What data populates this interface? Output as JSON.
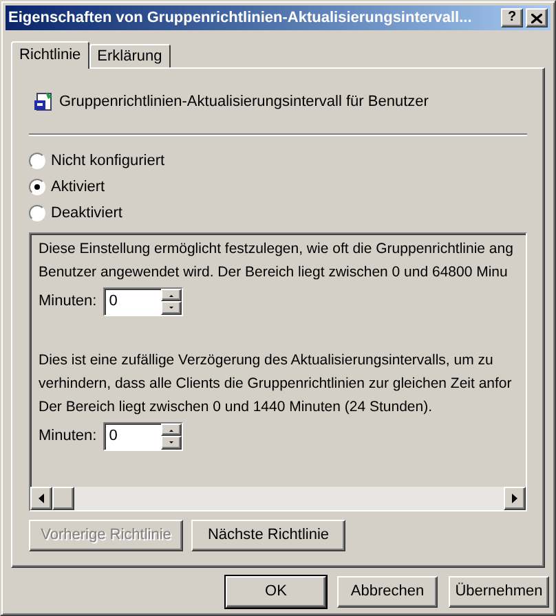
{
  "window": {
    "title": "Eigenschaften von Gruppenrichtlinien-Aktualisierungsintervall...",
    "help_button": "?"
  },
  "tabs": [
    {
      "label": "Richtlinie",
      "selected": true
    },
    {
      "label": "Erklärung",
      "selected": false
    }
  ],
  "policy": {
    "name": "Gruppenrichtlinien-Aktualisierungsintervall für Benutzer"
  },
  "options": [
    {
      "label": "Nicht konfiguriert",
      "selected": false
    },
    {
      "label": "Aktiviert",
      "selected": true
    },
    {
      "label": "Deaktiviert",
      "selected": false
    }
  ],
  "settings": [
    {
      "lines": [
        "Diese Einstellung ermöglicht festzulegen, wie oft die Gruppenrichtlinie ang",
        "Benutzer angewendet wird. Der Bereich liegt zwischen 0 und 64800 Minu"
      ],
      "field_label": "Minuten:",
      "value": "0"
    },
    {
      "lines": [
        "Dies ist eine zufällige Verzögerung des Aktualisierungsintervalls, um zu",
        "verhindern, dass alle Clients die Gruppenrichtlinien zur gleichen Zeit anfor",
        "Der Bereich liegt zwischen 0 und 1440 Minuten (24 Stunden)."
      ],
      "field_label": "Minuten:",
      "value": "0"
    }
  ],
  "nav_buttons": [
    {
      "label": "Vorherige Richtlinie",
      "disabled": true
    },
    {
      "label": "Nächste Richtlinie",
      "disabled": false
    }
  ],
  "buttons": [
    {
      "label": "OK",
      "default": true
    },
    {
      "label": "Abbrechen",
      "default": false
    },
    {
      "label": "Übernehmen",
      "default": false
    }
  ]
}
